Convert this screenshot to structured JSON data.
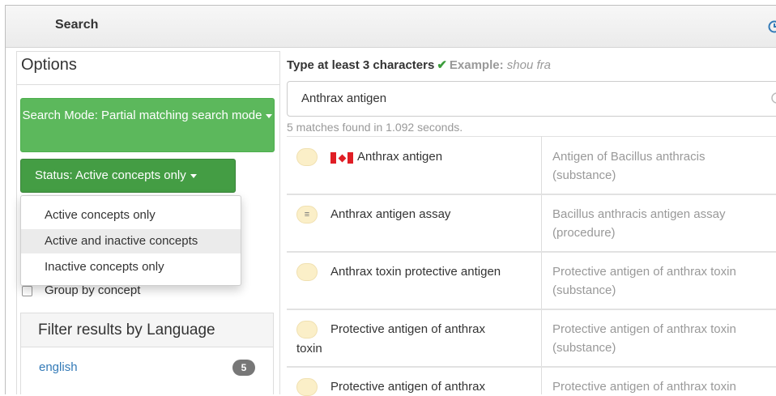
{
  "header": {
    "title": "Search",
    "history_icon": "history-icon"
  },
  "options": {
    "title": "Options",
    "search_mode_label": "Search Mode: Partial matching search mode",
    "status_label": "Status: Active concepts only",
    "status_menu": [
      "Active concepts only",
      "Active and inactive concepts",
      "Inactive concepts only"
    ],
    "hovered_item": "Active and inactive concepts",
    "group_by_concept_label": "Group by concept",
    "group_by_concept_checked": false,
    "accent_green": "#5cb85c"
  },
  "language_filter": {
    "title": "Filter results by Language",
    "items": [
      {
        "label": "english",
        "count": "5"
      }
    ]
  },
  "search": {
    "hint_prefix": "Type at least 3 characters",
    "hint_check": "✔",
    "example_label": "Example:",
    "example_value": "shou fra",
    "query": "Anthrax antigen",
    "matches_text": "5 matches found in 1.092 seconds."
  },
  "results": [
    {
      "icon": "concept-pill-icon",
      "flag": "canada-flag-icon",
      "term": "Anthrax antigen",
      "description": "Antigen of Bacillus anthracis (substance)"
    },
    {
      "icon": "list-lines-icon",
      "term": "Anthrax antigen assay",
      "description": "Bacillus anthracis antigen assay (procedure)"
    },
    {
      "icon": "concept-pill-icon",
      "term": "Anthrax toxin protective antigen",
      "description": "Protective antigen of anthrax toxin (substance)"
    },
    {
      "icon": "concept-pill-icon",
      "term_line1": "Protective antigen of anthrax",
      "term_line2": "toxin",
      "description": "Protective antigen of anthrax toxin (substance)"
    },
    {
      "icon": "concept-pill-icon",
      "term_line1": "Protective antigen of anthrax",
      "description": "Protective antigen of anthrax toxin"
    }
  ]
}
